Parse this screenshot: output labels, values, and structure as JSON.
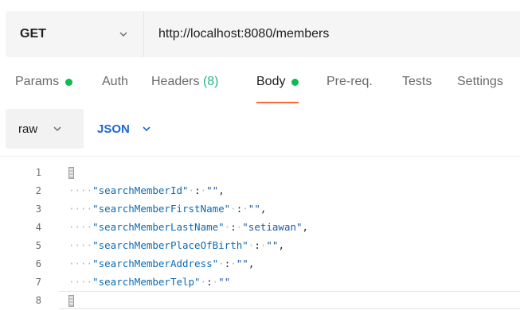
{
  "request": {
    "method": "GET",
    "url": "http://localhost:8080/members"
  },
  "tabs": [
    {
      "label": "Params",
      "has_dot": true
    },
    {
      "label": "Auth"
    },
    {
      "label": "Headers",
      "count": "(8)"
    },
    {
      "label": "Body",
      "has_dot": true,
      "active": true
    },
    {
      "label": "Pre-req."
    },
    {
      "label": "Tests"
    },
    {
      "label": "Settings"
    }
  ],
  "body_options": {
    "mode": "raw",
    "language": "JSON"
  },
  "editor": {
    "line_numbers": [
      "1",
      "2",
      "3",
      "4",
      "5",
      "6",
      "7",
      "8"
    ],
    "open_brace": "{",
    "close_brace": "}",
    "fields": [
      {
        "key": "\"searchMemberId\"",
        "value": "\"\"",
        "trail": ","
      },
      {
        "key": "\"searchMemberFirstName\"",
        "value": "\"\"",
        "trail": ","
      },
      {
        "key": "\"searchMemberLastName\"",
        "value": "\"setiawan\"",
        "trail": ","
      },
      {
        "key": "\"searchMemberPlaceOfBirth\"",
        "value": "\"\"",
        "trail": ","
      },
      {
        "key": "\"searchMemberAddress\"",
        "value": "\"\"",
        "trail": ","
      },
      {
        "key": "\"searchMemberTelp\"",
        "value": "\"\"",
        "trail": ""
      }
    ]
  },
  "colors": {
    "accent": "#ff6c37",
    "status_dot": "#0cbb52",
    "json_label": "#1f67d2"
  },
  "icons": {
    "method_dropdown": "chevron-down-icon",
    "mode_dropdown": "chevron-down-icon",
    "language_dropdown": "chevron-down-icon"
  }
}
